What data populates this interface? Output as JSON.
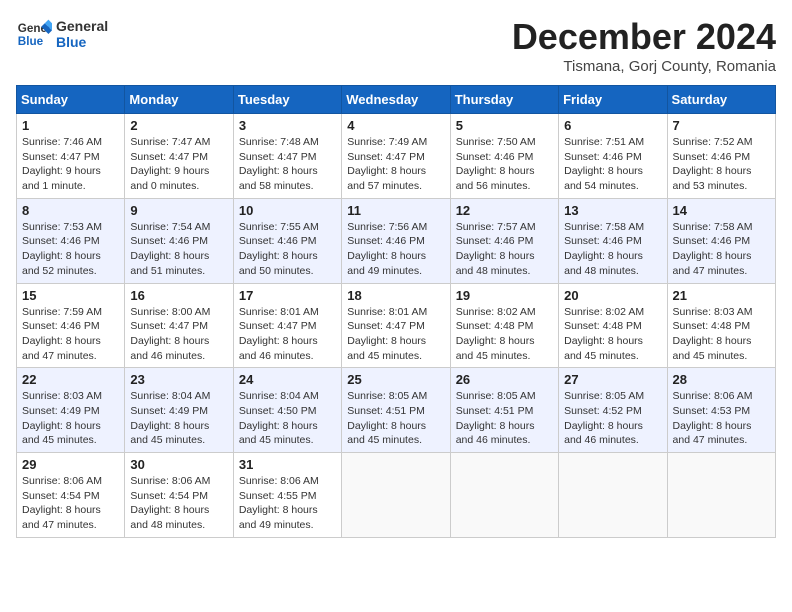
{
  "header": {
    "logo_general": "General",
    "logo_blue": "Blue",
    "month_title": "December 2024",
    "location": "Tismana, Gorj County, Romania"
  },
  "calendar": {
    "days_of_week": [
      "Sunday",
      "Monday",
      "Tuesday",
      "Wednesday",
      "Thursday",
      "Friday",
      "Saturday"
    ],
    "weeks": [
      [
        null,
        null,
        null,
        null,
        null,
        null,
        null,
        {
          "day": "1",
          "detail": "Sunrise: 7:46 AM\nSunset: 4:47 PM\nDaylight: 9 hours and 1 minute."
        },
        {
          "day": "2",
          "detail": "Sunrise: 7:47 AM\nSunset: 4:47 PM\nDaylight: 9 hours and 0 minutes."
        },
        {
          "day": "3",
          "detail": "Sunrise: 7:48 AM\nSunset: 4:47 PM\nDaylight: 8 hours and 58 minutes."
        },
        {
          "day": "4",
          "detail": "Sunrise: 7:49 AM\nSunset: 4:47 PM\nDaylight: 8 hours and 57 minutes."
        },
        {
          "day": "5",
          "detail": "Sunrise: 7:50 AM\nSunset: 4:46 PM\nDaylight: 8 hours and 56 minutes."
        },
        {
          "day": "6",
          "detail": "Sunrise: 7:51 AM\nSunset: 4:46 PM\nDaylight: 8 hours and 54 minutes."
        },
        {
          "day": "7",
          "detail": "Sunrise: 7:52 AM\nSunset: 4:46 PM\nDaylight: 8 hours and 53 minutes."
        }
      ],
      [
        {
          "day": "8",
          "detail": "Sunrise: 7:53 AM\nSunset: 4:46 PM\nDaylight: 8 hours and 52 minutes."
        },
        {
          "day": "9",
          "detail": "Sunrise: 7:54 AM\nSunset: 4:46 PM\nDaylight: 8 hours and 51 minutes."
        },
        {
          "day": "10",
          "detail": "Sunrise: 7:55 AM\nSunset: 4:46 PM\nDaylight: 8 hours and 50 minutes."
        },
        {
          "day": "11",
          "detail": "Sunrise: 7:56 AM\nSunset: 4:46 PM\nDaylight: 8 hours and 49 minutes."
        },
        {
          "day": "12",
          "detail": "Sunrise: 7:57 AM\nSunset: 4:46 PM\nDaylight: 8 hours and 48 minutes."
        },
        {
          "day": "13",
          "detail": "Sunrise: 7:58 AM\nSunset: 4:46 PM\nDaylight: 8 hours and 48 minutes."
        },
        {
          "day": "14",
          "detail": "Sunrise: 7:58 AM\nSunset: 4:46 PM\nDaylight: 8 hours and 47 minutes."
        }
      ],
      [
        {
          "day": "15",
          "detail": "Sunrise: 7:59 AM\nSunset: 4:46 PM\nDaylight: 8 hours and 47 minutes."
        },
        {
          "day": "16",
          "detail": "Sunrise: 8:00 AM\nSunset: 4:47 PM\nDaylight: 8 hours and 46 minutes."
        },
        {
          "day": "17",
          "detail": "Sunrise: 8:01 AM\nSunset: 4:47 PM\nDaylight: 8 hours and 46 minutes."
        },
        {
          "day": "18",
          "detail": "Sunrise: 8:01 AM\nSunset: 4:47 PM\nDaylight: 8 hours and 45 minutes."
        },
        {
          "day": "19",
          "detail": "Sunrise: 8:02 AM\nSunset: 4:48 PM\nDaylight: 8 hours and 45 minutes."
        },
        {
          "day": "20",
          "detail": "Sunrise: 8:02 AM\nSunset: 4:48 PM\nDaylight: 8 hours and 45 minutes."
        },
        {
          "day": "21",
          "detail": "Sunrise: 8:03 AM\nSunset: 4:48 PM\nDaylight: 8 hours and 45 minutes."
        }
      ],
      [
        {
          "day": "22",
          "detail": "Sunrise: 8:03 AM\nSunset: 4:49 PM\nDaylight: 8 hours and 45 minutes."
        },
        {
          "day": "23",
          "detail": "Sunrise: 8:04 AM\nSunset: 4:49 PM\nDaylight: 8 hours and 45 minutes."
        },
        {
          "day": "24",
          "detail": "Sunrise: 8:04 AM\nSunset: 4:50 PM\nDaylight: 8 hours and 45 minutes."
        },
        {
          "day": "25",
          "detail": "Sunrise: 8:05 AM\nSunset: 4:51 PM\nDaylight: 8 hours and 45 minutes."
        },
        {
          "day": "26",
          "detail": "Sunrise: 8:05 AM\nSunset: 4:51 PM\nDaylight: 8 hours and 46 minutes."
        },
        {
          "day": "27",
          "detail": "Sunrise: 8:05 AM\nSunset: 4:52 PM\nDaylight: 8 hours and 46 minutes."
        },
        {
          "day": "28",
          "detail": "Sunrise: 8:06 AM\nSunset: 4:53 PM\nDaylight: 8 hours and 47 minutes."
        }
      ],
      [
        {
          "day": "29",
          "detail": "Sunrise: 8:06 AM\nSunset: 4:54 PM\nDaylight: 8 hours and 47 minutes."
        },
        {
          "day": "30",
          "detail": "Sunrise: 8:06 AM\nSunset: 4:54 PM\nDaylight: 8 hours and 48 minutes."
        },
        {
          "day": "31",
          "detail": "Sunrise: 8:06 AM\nSunset: 4:55 PM\nDaylight: 8 hours and 49 minutes."
        },
        null,
        null,
        null,
        null
      ]
    ]
  }
}
